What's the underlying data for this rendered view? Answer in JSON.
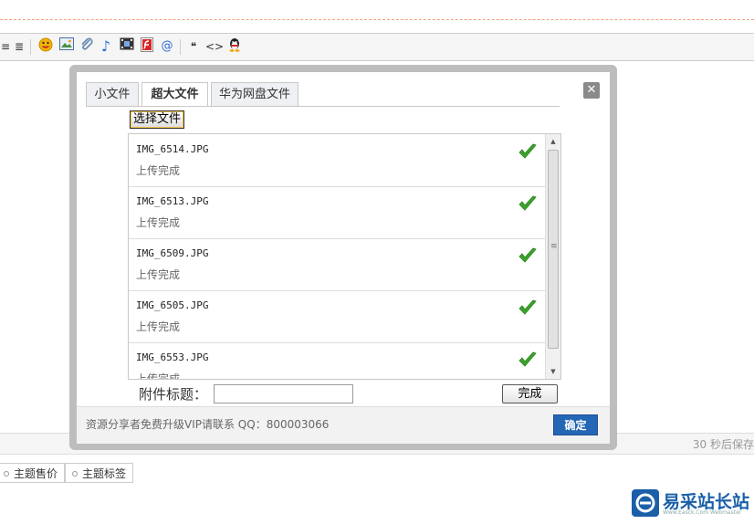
{
  "toolbar": {
    "icons": [
      "align-center-icon",
      "align-right-icon",
      "emoticon-icon",
      "image-icon",
      "attachment-icon",
      "music-icon",
      "video-icon",
      "flash-icon",
      "mention-icon",
      "quote-icon",
      "code-icon",
      "qq-icon"
    ],
    "glyphs": {
      "quote": "❝",
      "code": "<>",
      "mention": "@",
      "music": "♪"
    }
  },
  "editor_status": {
    "text": "30 秒后保存"
  },
  "bottom_buttons": [
    {
      "label": "主题售价"
    },
    {
      "label": "主题标签"
    }
  ],
  "watermark": {
    "logo_text": "易采站长站",
    "sub_text": "Www.Easck.Com Webmaster"
  },
  "dialog": {
    "tabs": [
      {
        "label": "小文件",
        "active": false
      },
      {
        "label": "超大文件",
        "active": true
      },
      {
        "label": "华为网盘文件",
        "active": false
      }
    ],
    "close_glyph": "✕",
    "select_button": "选择文件",
    "files": [
      {
        "name": "IMG_6514.JPG",
        "status": "上传完成"
      },
      {
        "name": "IMG_6513.JPG",
        "status": "上传完成"
      },
      {
        "name": "IMG_6509.JPG",
        "status": "上传完成"
      },
      {
        "name": "IMG_6505.JPG",
        "status": "上传完成"
      },
      {
        "name": "IMG_6553.JPG",
        "status": "上传完成"
      }
    ],
    "attach_title_label": "附件标题：",
    "attach_title_value": "",
    "done_button": "完成",
    "footer_text": "资源分享者免费升级VIP请联系 QQ：800003066",
    "confirm_button": "确定"
  },
  "colors": {
    "accent": "#2366b5",
    "check": "#3aa52a",
    "dashed_line": "#f0a27a"
  }
}
